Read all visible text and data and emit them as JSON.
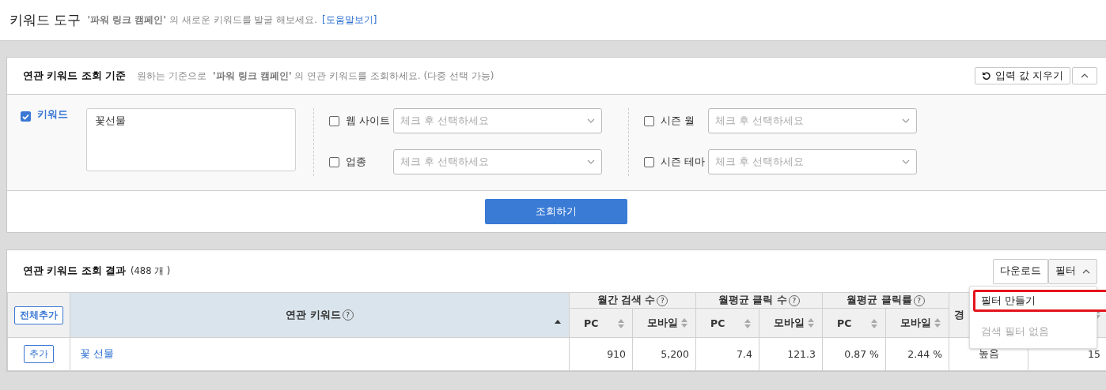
{
  "header": {
    "title": "키워드 도구",
    "text": "**'파워 링크 캠페인'** 의 새로운 키워드를 발굴 해보세요.",
    "help_link": "[도움말보기]"
  },
  "criteria": {
    "title": "연관 키워드 조회 기준",
    "description": "**'파워 링크 캠페인'** 의 연관 키워드를 조회하세요. (다중 선택 가능)",
    "description_prefix": "원하는 기준으로",
    "reset_button": "입력 값 지우기",
    "keyword": {
      "label": "키워드",
      "checked": true,
      "value": "꽃선물"
    },
    "filters": [
      {
        "label": "웹 사이트",
        "checked": false,
        "placeholder": "체크 후 선택하세요"
      },
      {
        "label": "업종",
        "checked": false,
        "placeholder": "체크 후 선택하세요"
      },
      {
        "label": "시즌 월",
        "checked": false,
        "placeholder": "체크 후 선택하세요"
      },
      {
        "label": "시즌 테마",
        "checked": false,
        "placeholder": "체크 후 선택하세요"
      }
    ],
    "search_button": "조회하기"
  },
  "results": {
    "title": "연관 키워드 조회 결과",
    "count": "(488 개 )",
    "download_button": "다운로드",
    "filter_button": "필터",
    "filter_menu": [
      {
        "label": "필터 만들기",
        "selected": true,
        "disabled": false
      },
      {
        "label": "검색 필터 없음",
        "selected": false,
        "disabled": true
      }
    ],
    "columns": [
      {
        "kind": "add_all",
        "label": "전체추가"
      },
      {
        "kind": "keyword",
        "label": "연관 키워드",
        "help": "?"
      },
      {
        "kind": "group",
        "label": "월간 검색 수",
        "help": "?",
        "sub": [
          "PC",
          "모바일"
        ]
      },
      {
        "kind": "group",
        "label": "월평균 클릭 수",
        "help": "?",
        "sub": [
          "PC",
          "모바일"
        ]
      },
      {
        "kind": "group",
        "label": "월평균 클릭률",
        "help": "?",
        "sub": [
          "PC",
          "모바일"
        ]
      },
      {
        "kind": "single",
        "label": "경"
      },
      {
        "kind": "sort_only"
      }
    ],
    "rows": [
      {
        "add": "추가",
        "keyword": "꽃 선물",
        "values": [
          "910",
          "5,200",
          "7.4",
          "121.3",
          "0.87 %",
          "2.44 %"
        ],
        "competition": "높음",
        "column_10": "15"
      }
    ]
  }
}
